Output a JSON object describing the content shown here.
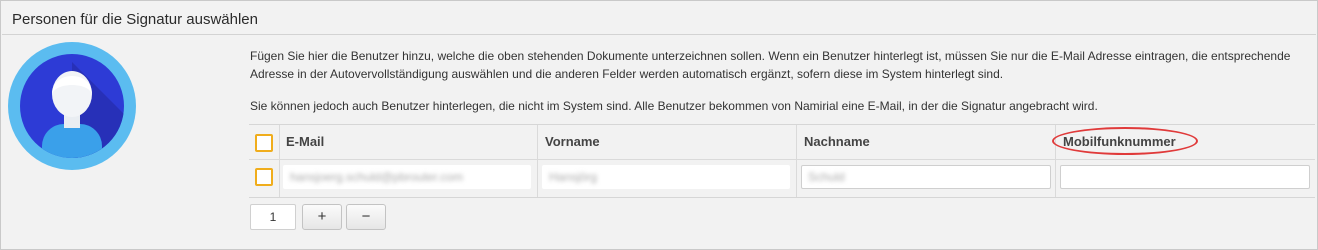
{
  "panel": {
    "title": "Personen für die Signatur auswählen"
  },
  "intro": {
    "paragraph1": "Fügen Sie hier die Benutzer hinzu, welche die oben stehenden Dokumente unterzeichnen sollen. Wenn ein Benutzer hinterlegt ist, müssen Sie nur die E-Mail Adresse eintragen, die entsprechende Adresse in der Autovervollständigung auswählen und die anderen Felder werden automatisch ergänzt, sofern diese im System hinterlegt sind.",
    "paragraph2": "Sie können jedoch auch Benutzer hinterlegen, die nicht im System sind. Alle Benutzer bekommen von Namirial eine E-Mail, in der die Signatur angebracht wird."
  },
  "table": {
    "headers": {
      "email": "E-Mail",
      "vorname": "Vorname",
      "nachname": "Nachname",
      "mobil": "Mobilfunknummer"
    },
    "rows": [
      {
        "email": "hansjoerg.schuld@pbrouter.com",
        "vorname": "Hansjörg",
        "nachname": "Schuld",
        "mobil": ""
      }
    ]
  },
  "controls": {
    "count": "1",
    "add_label": "+",
    "remove_label": "−"
  },
  "icons": {
    "avatar": "user-avatar-icon"
  },
  "colors": {
    "checkbox_border": "#f0ad1c",
    "annotation": "#e03a3a",
    "avatar_ring": "#5bbcf0",
    "avatar_inner": "#2d3bd6"
  }
}
